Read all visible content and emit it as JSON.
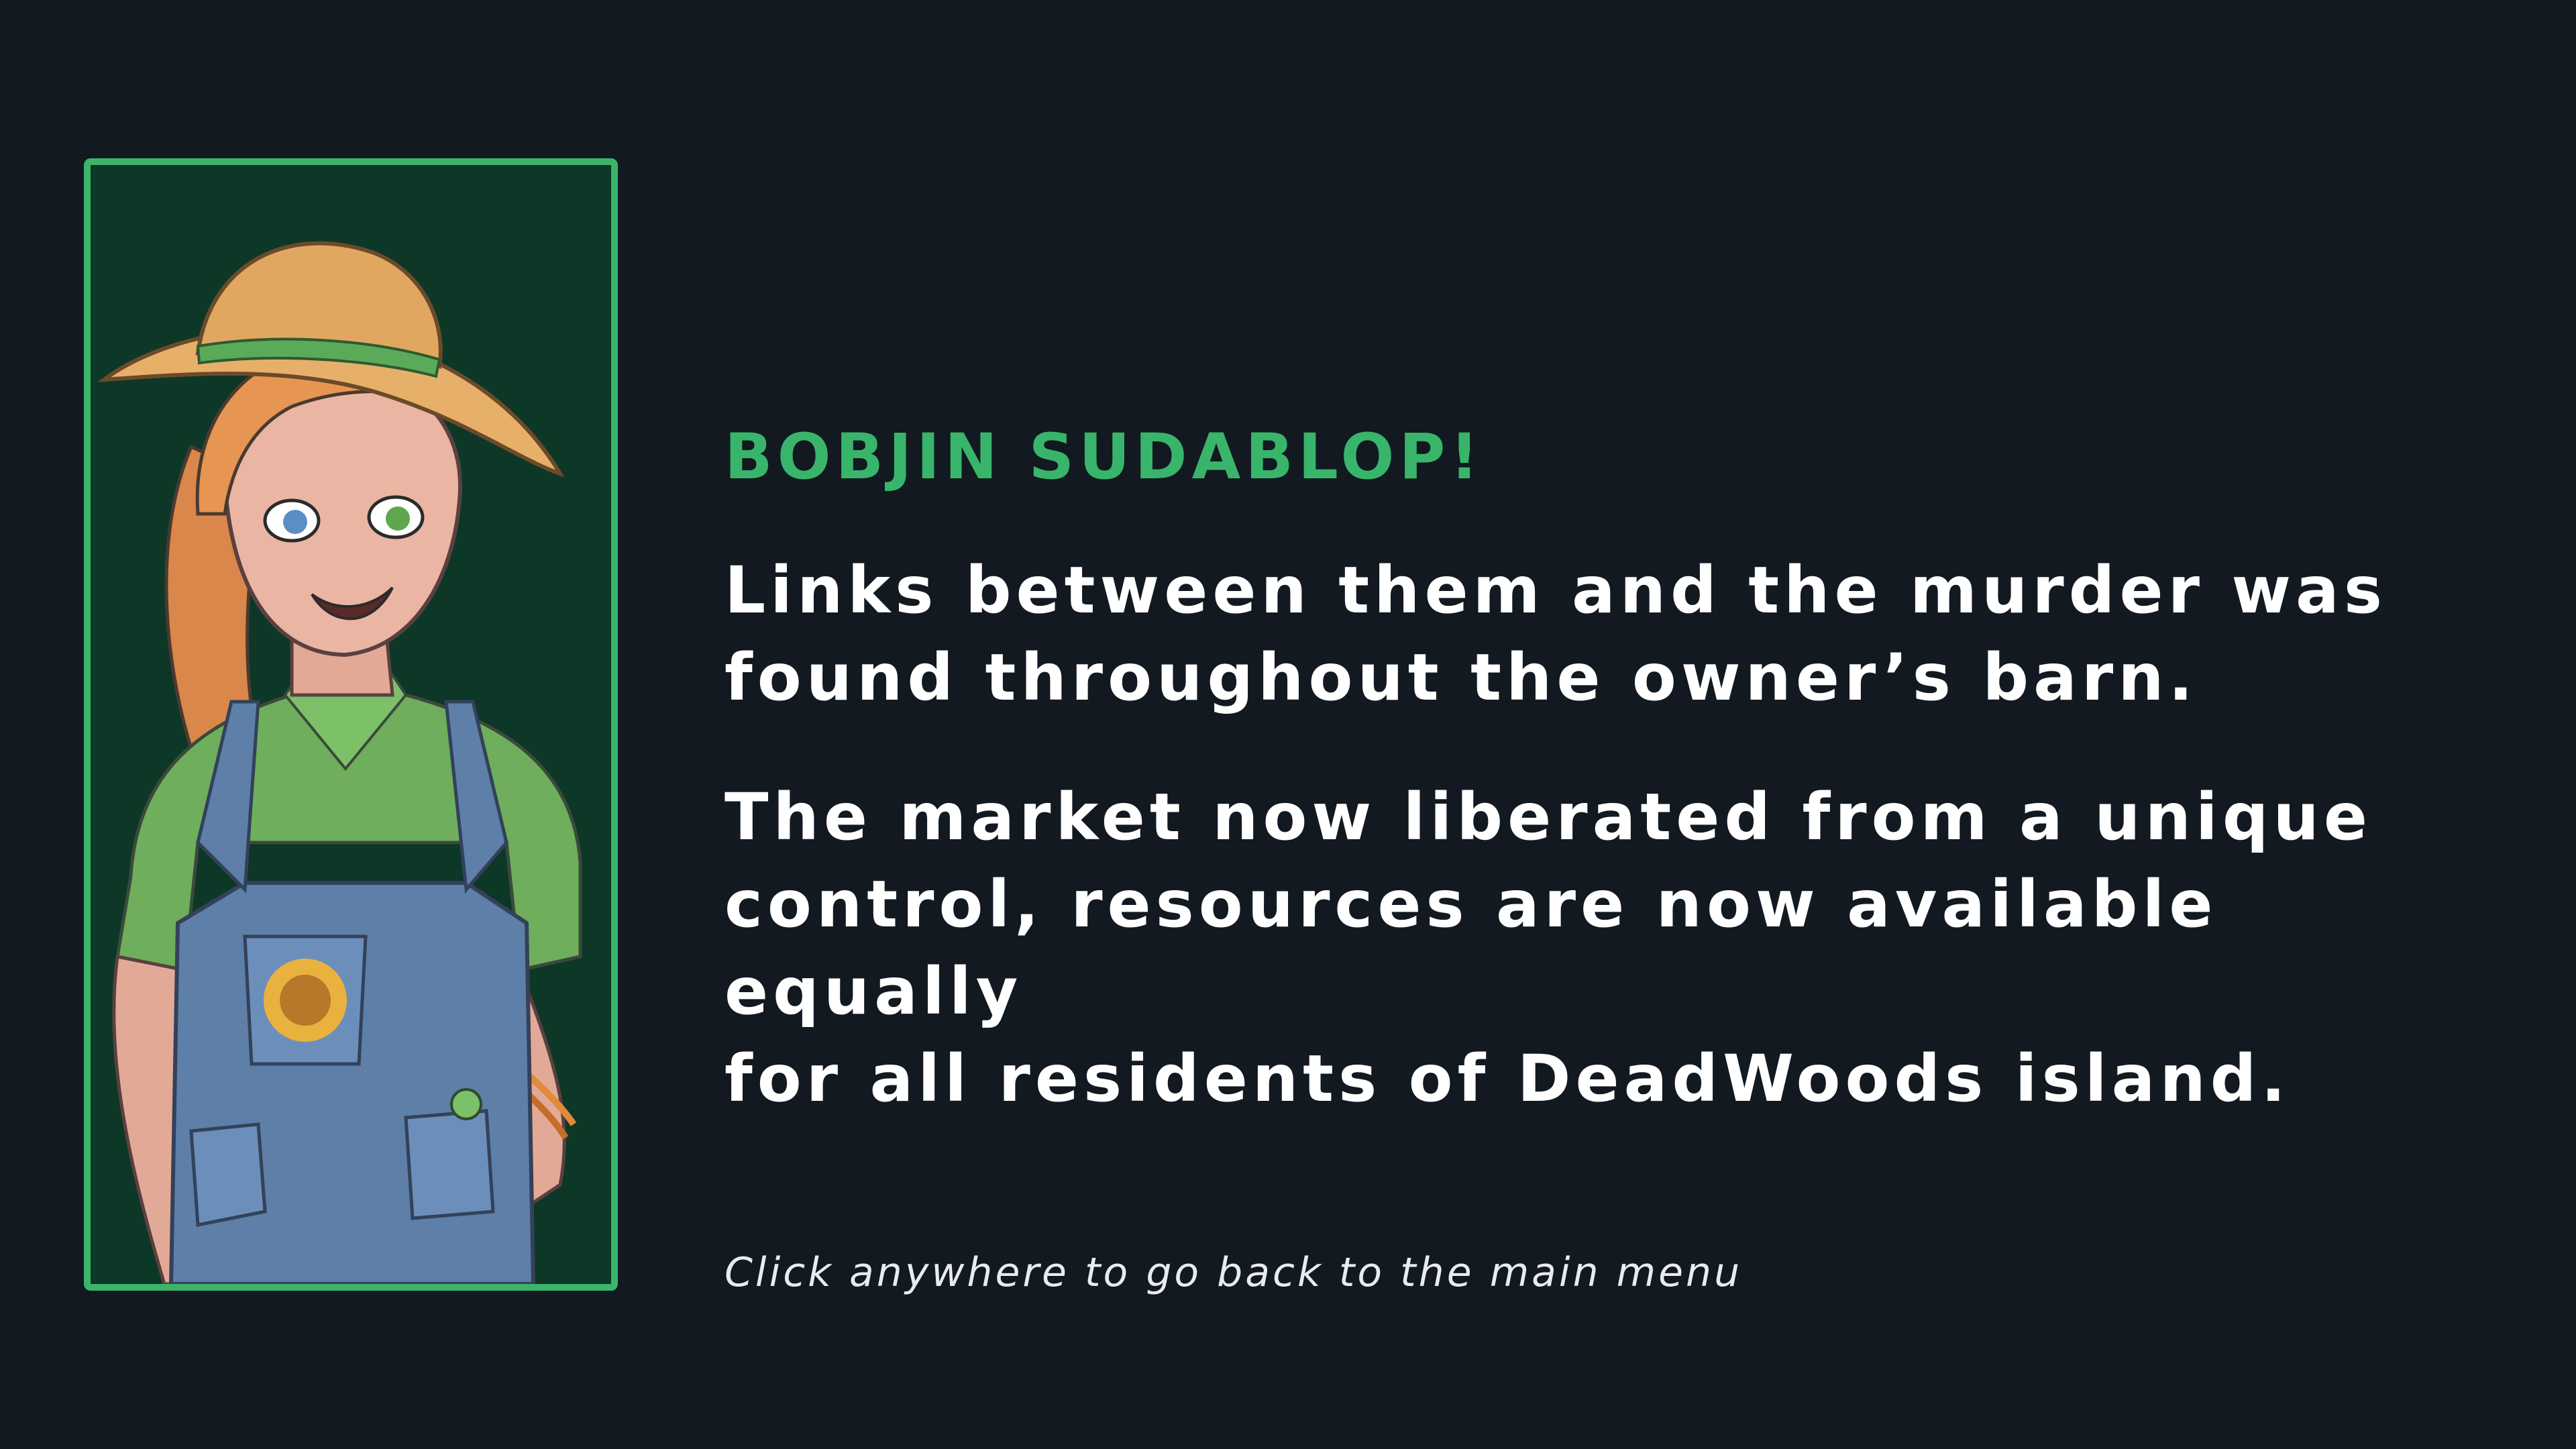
{
  "character": {
    "name": "BOBJIN SUDABLOP!",
    "portrait": "farmer-character-portrait"
  },
  "paragraphs": [
    "Links between them and the murder was\nfound throughout the owner’s barn.",
    "The market now liberated from a unique\ncontrol, resources are now available equally\nfor all residents of DeadWoods island."
  ],
  "hint": "Click anywhere to go back to the main menu",
  "colors": {
    "background": "#121920",
    "accent": "#3ab56a",
    "portrait_background": "#0d3727",
    "text": "#ffffff"
  }
}
